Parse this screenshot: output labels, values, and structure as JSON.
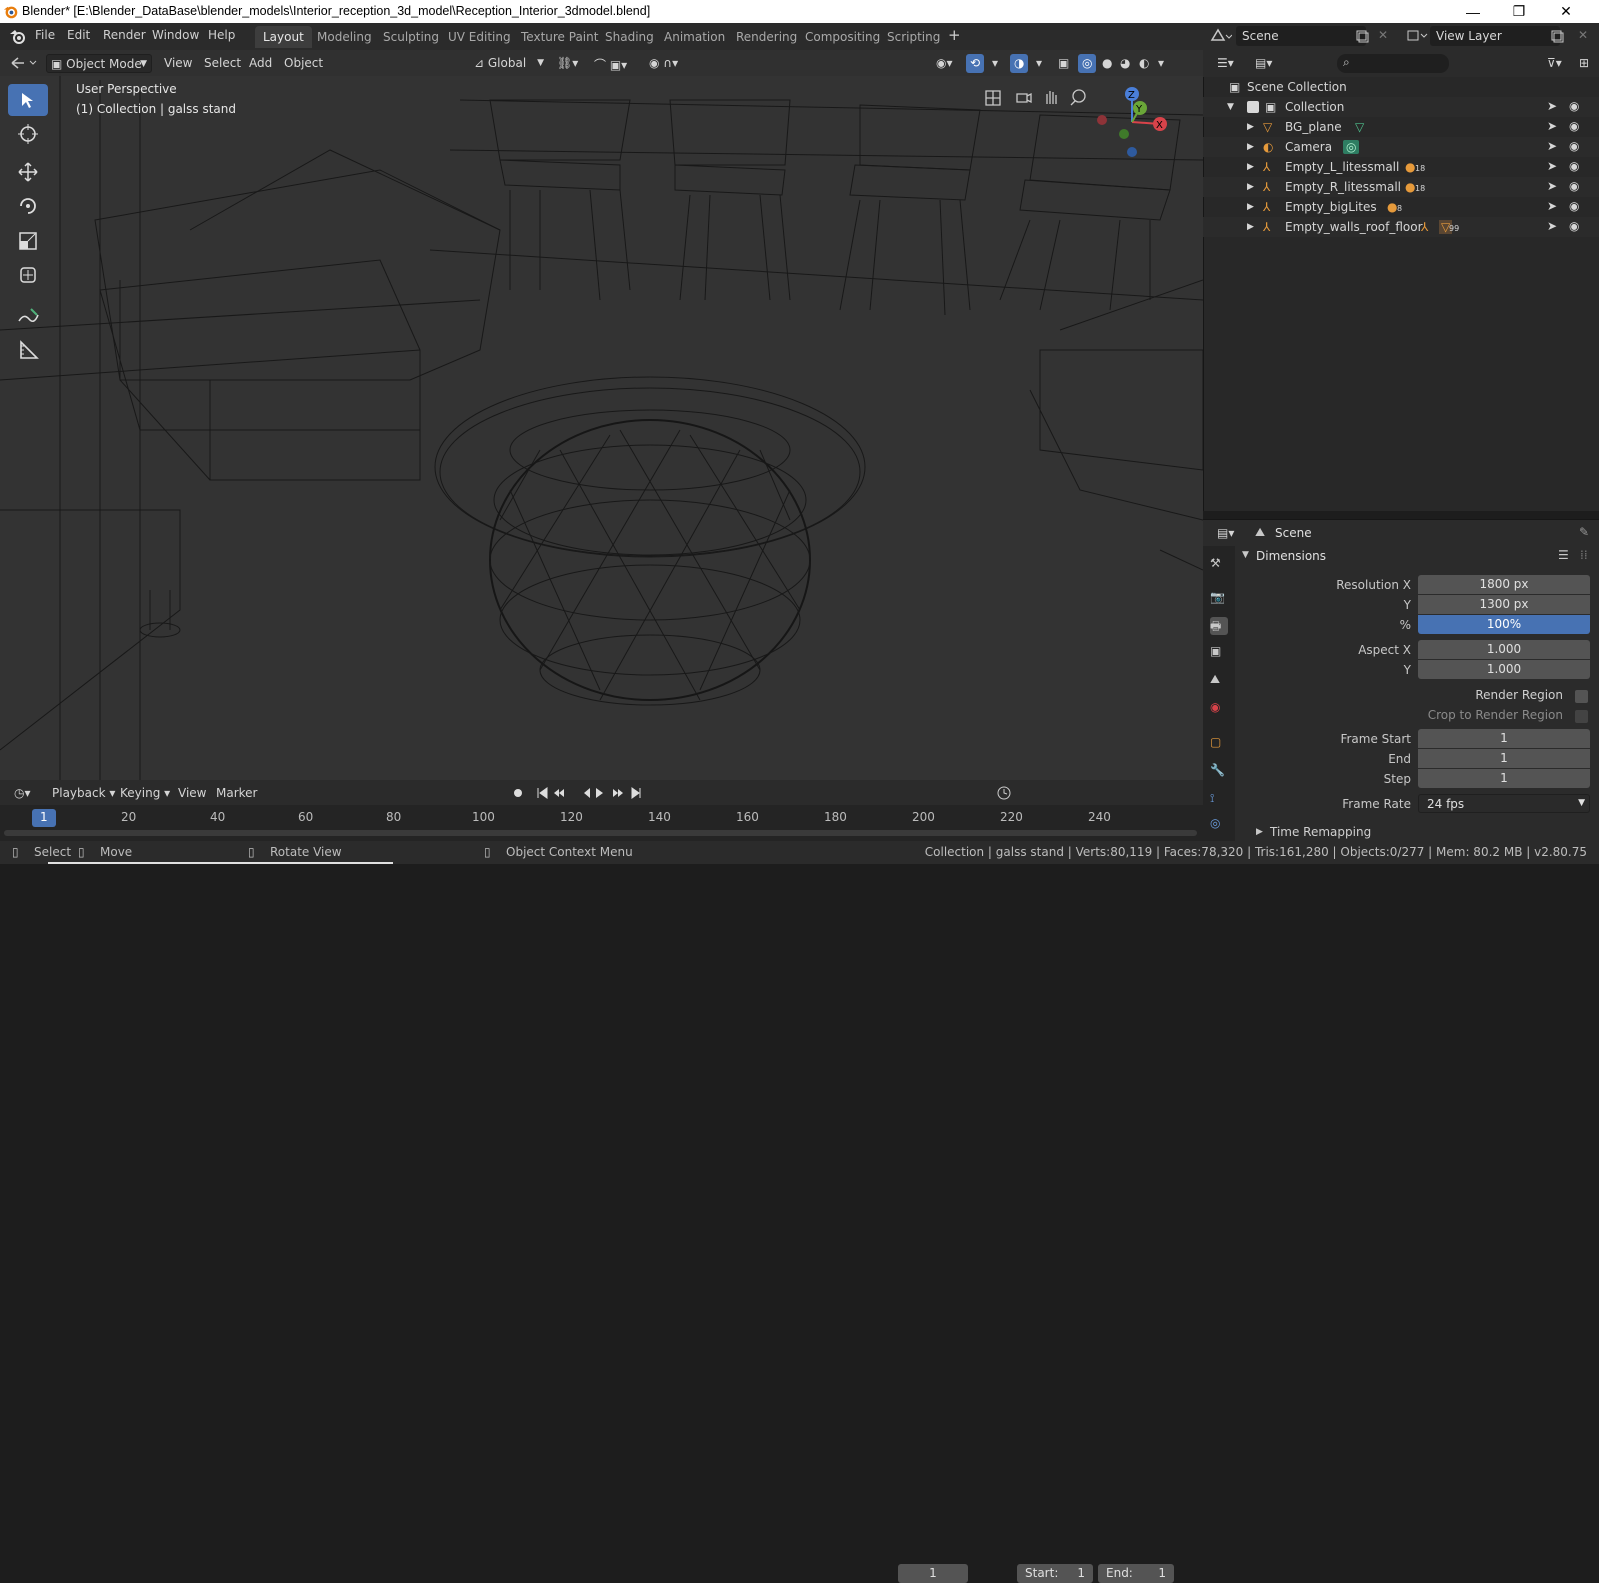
{
  "window": {
    "title": "Blender* [E:\\Blender_DataBase\\blender_models\\Interior_reception_3d_model\\Reception_Interior_3dmodel.blend]",
    "minimize": "—",
    "maximize": "❐",
    "close": "✕"
  },
  "menus": [
    "File",
    "Edit",
    "Render",
    "Window",
    "Help"
  ],
  "workspaces": [
    "Layout",
    "Modeling",
    "Sculpting",
    "UV Editing",
    "Texture Paint",
    "Shading",
    "Animation",
    "Rendering",
    "Compositing",
    "Scripting"
  ],
  "active_workspace": "Layout",
  "add_workspace": "+",
  "scene_selector": {
    "label": "Scene"
  },
  "view_layer_selector": {
    "label": "View Layer"
  },
  "viewport_header": {
    "mode": "Object Mode",
    "view": "View",
    "select": "Select",
    "add": "Add",
    "object": "Object",
    "orientation": "Global"
  },
  "viewport_overlay": {
    "line1": "User Perspective",
    "line2": "(1) Collection | galss stand"
  },
  "gizmo_axes": {
    "x": "X",
    "y": "Y",
    "z": "Z"
  },
  "outliner": {
    "root": "Scene Collection",
    "collection": "Collection",
    "items": [
      {
        "name": "BG_plane",
        "icon": "mesh-icon",
        "badge": ""
      },
      {
        "name": "Camera",
        "icon": "camera-icon",
        "badge": ""
      },
      {
        "name": "Empty_L_litessmall",
        "icon": "empty-icon",
        "badge": "18"
      },
      {
        "name": "Empty_R_litessmall",
        "icon": "empty-icon",
        "badge": "18"
      },
      {
        "name": "Empty_bigLites",
        "icon": "empty-icon",
        "badge": "8"
      },
      {
        "name": "Empty_walls_roof_floor",
        "icon": "empty-icon",
        "badge": "99"
      }
    ]
  },
  "properties": {
    "context": "Scene",
    "panel": "Dimensions",
    "fields": {
      "resolution_x_label": "Resolution X",
      "resolution_x": "1800 px",
      "resolution_y_label": "Y",
      "resolution_y": "1300 px",
      "percent_label": "%",
      "percent": "100%",
      "aspect_x_label": "Aspect X",
      "aspect_x": "1.000",
      "aspect_y_label": "Y",
      "aspect_y": "1.000",
      "render_region": "Render Region",
      "crop_region": "Crop to Render Region",
      "frame_start_label": "Frame Start",
      "frame_start": "1",
      "end_label": "End",
      "end": "1",
      "step_label": "Step",
      "step": "1",
      "frame_rate_label": "Frame Rate",
      "frame_rate": "24 fps",
      "time_remapping": "Time Remapping"
    }
  },
  "timeline": {
    "playback": "Playback",
    "keying": "Keying",
    "view": "View",
    "marker": "Marker",
    "current_frame": "1",
    "start_label": "Start:",
    "start": "1",
    "end_label": "End:",
    "end": "1",
    "ruler": [
      "1",
      "20",
      "40",
      "60",
      "80",
      "100",
      "120",
      "140",
      "160",
      "180",
      "200",
      "220",
      "240"
    ]
  },
  "statusbar": {
    "select": "Select",
    "move": "Move",
    "rotate": "Rotate View",
    "context_menu": "Object Context Menu",
    "stats": "Collection | galss stand | Verts:80,119 | Faces:78,320 | Tris:161,280 | Objects:0/277 | Mem: 80.2 MB | v2.80.75"
  }
}
